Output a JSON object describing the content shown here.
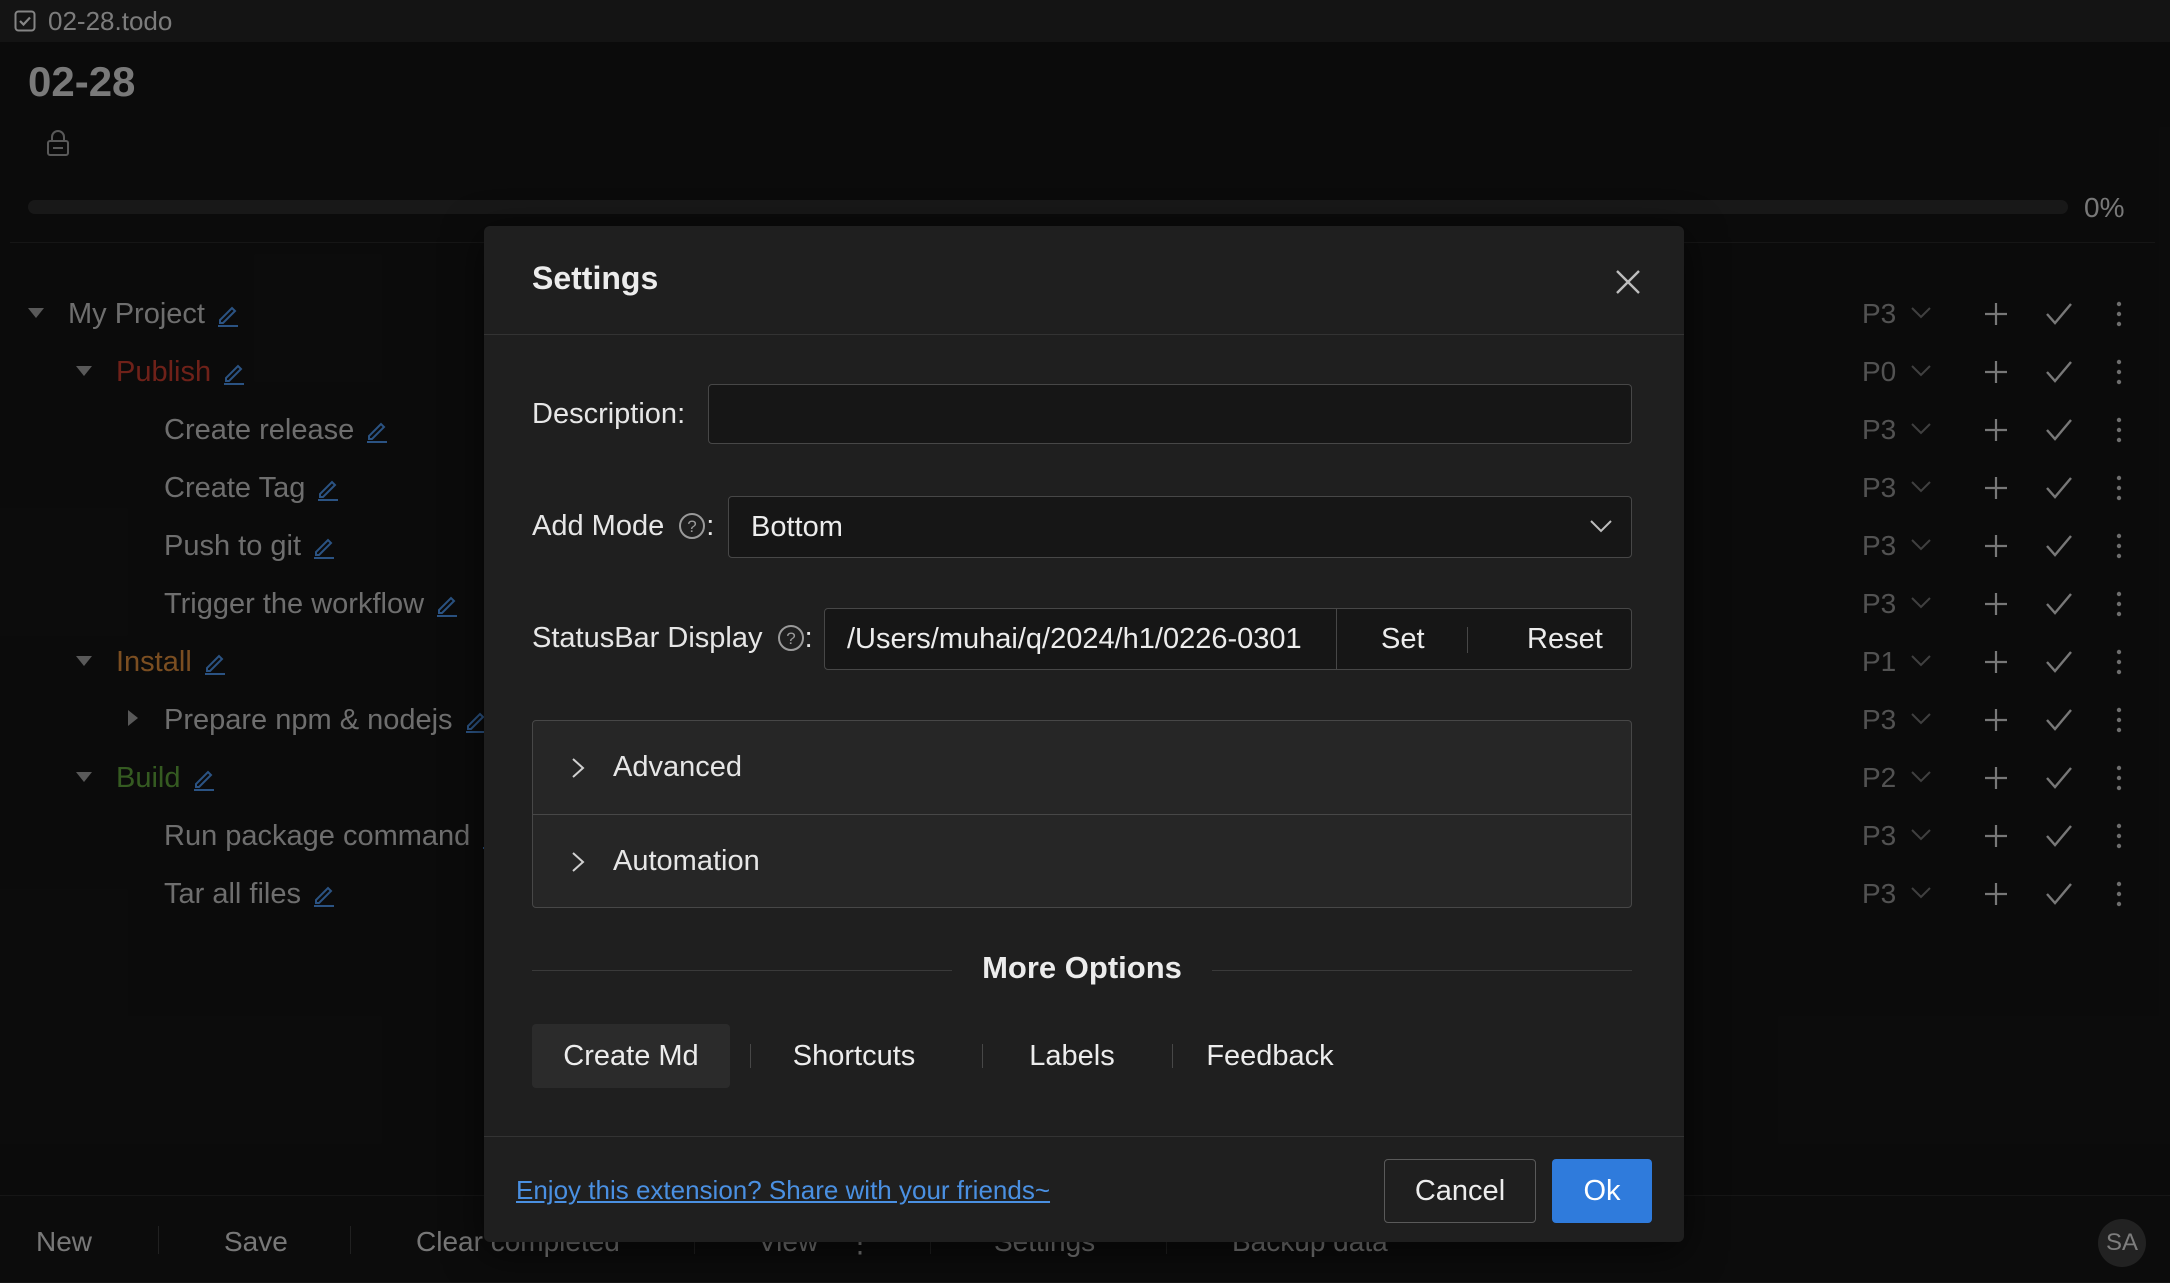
{
  "window": {
    "file_name": "02-28.todo"
  },
  "page": {
    "title": "02-28",
    "progress_label": "0%",
    "progress": 0
  },
  "colors": {
    "accent": "#2f7bdc",
    "publish": "#c0392b",
    "install": "#d4873a",
    "build": "#5c9e3a",
    "default_text": "#bdbdbd"
  },
  "tree": [
    {
      "label": "My Project",
      "priority": "P3",
      "indent": 0,
      "caret": "down",
      "color": "#bdbdbd"
    },
    {
      "label": "Publish",
      "priority": "P0",
      "indent": 1,
      "caret": "down",
      "color": "#c0392b"
    },
    {
      "label": "Create release",
      "priority": "P3",
      "indent": 2,
      "caret": "none",
      "color": "#bdbdbd"
    },
    {
      "label": "Create Tag",
      "priority": "P3",
      "indent": 2,
      "caret": "none",
      "color": "#bdbdbd"
    },
    {
      "label": "Push to git",
      "priority": "P3",
      "indent": 2,
      "caret": "none",
      "color": "#bdbdbd"
    },
    {
      "label": "Trigger the workflow",
      "priority": "P3",
      "indent": 2,
      "caret": "none",
      "color": "#bdbdbd"
    },
    {
      "label": "Install",
      "priority": "P1",
      "indent": 1,
      "caret": "down",
      "color": "#d4873a"
    },
    {
      "label": "Prepare npm & nodejs",
      "priority": "P3",
      "indent": 2,
      "caret": "right",
      "color": "#bdbdbd"
    },
    {
      "label": "Build",
      "priority": "P2",
      "indent": 1,
      "caret": "down",
      "color": "#5c9e3a"
    },
    {
      "label": "Run package command",
      "priority": "P3",
      "indent": 2,
      "caret": "none",
      "color": "#bdbdbd"
    },
    {
      "label": "Tar all files",
      "priority": "P3",
      "indent": 2,
      "caret": "none",
      "color": "#bdbdbd"
    }
  ],
  "bottom_bar": {
    "new": "New",
    "save": "Save",
    "clear_completed": "Clear completed",
    "view": "View",
    "settings": "Settings",
    "backup": "Backup data",
    "avatar": "SA"
  },
  "settings_modal": {
    "title": "Settings",
    "description_label": "Description",
    "description_value": "",
    "add_mode_label": "Add Mode",
    "add_mode_value": "Bottom",
    "statusbar_label": "StatusBar Display",
    "statusbar_path": "/Users/muhai/q/2024/h1/0226-0301",
    "set_label": "Set",
    "reset_label": "Reset",
    "advanced_label": "Advanced",
    "automation_label": "Automation",
    "more_options_label": "More Options",
    "options": [
      "Create Md",
      "Shortcuts",
      "Labels",
      "Feedback"
    ],
    "share_link": "Enjoy this extension? Share with your friends~",
    "cancel_label": "Cancel",
    "ok_label": "Ok"
  }
}
